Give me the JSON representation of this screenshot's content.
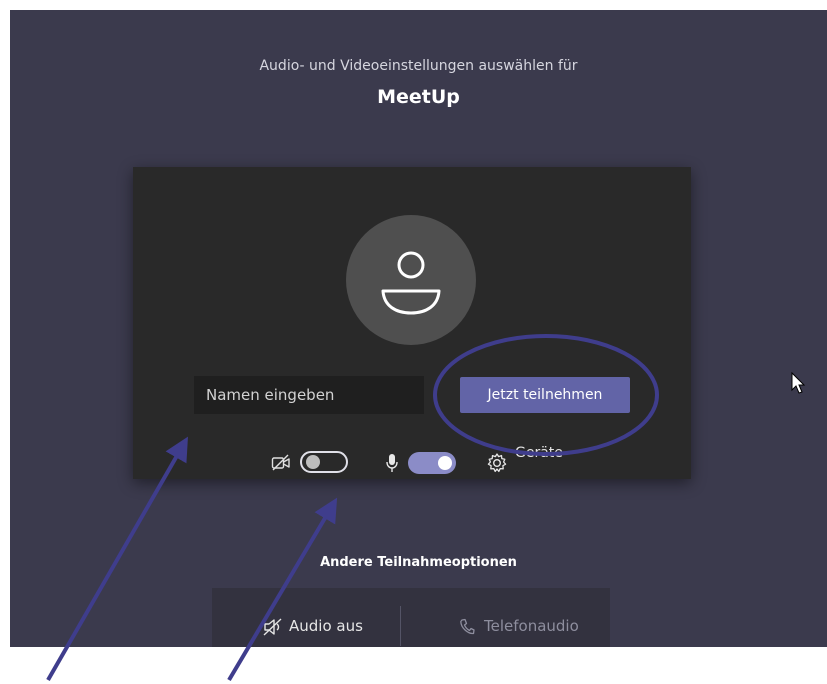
{
  "header": {
    "subtitle": "Audio- und Videoeinstellungen auswählen für",
    "meeting_name": "MeetUp"
  },
  "prejoin": {
    "avatar_icon": "person-icon",
    "name_input": {
      "value": "",
      "placeholder": "Namen eingeben"
    },
    "join_button_label": "Jetzt teilnehmen",
    "camera": {
      "icon": "camera-off-icon",
      "enabled": false
    },
    "microphone": {
      "icon": "microphone-icon",
      "enabled": true
    },
    "devices_label": "Geräte",
    "devices_icon": "gear-icon"
  },
  "other_options": {
    "heading": "Andere Teilnahmeoptionen",
    "audio_off_label": "Audio aus",
    "phone_audio_label": "Telefonaudio"
  },
  "colors": {
    "accent": "#6264a7",
    "background": "#3b3a4d",
    "card": "#292929",
    "annotation": "#3f3d8c"
  }
}
